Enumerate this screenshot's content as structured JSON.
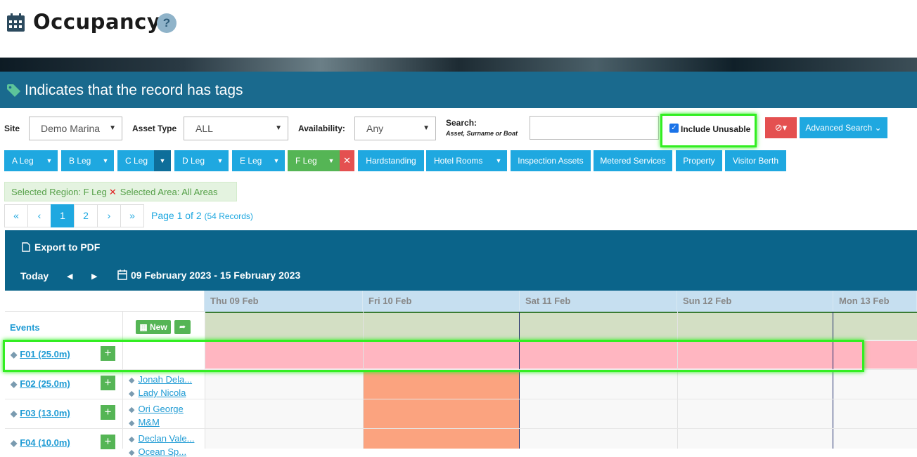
{
  "header": {
    "title": "Occupancy",
    "help": "?"
  },
  "tagbar": {
    "text": "Indicates that the record has tags"
  },
  "filters": {
    "site_label": "Site",
    "site_value": "Demo Marina",
    "asset_type_label": "Asset Type",
    "asset_type_value": "ALL",
    "availability_label": "Availability:",
    "availability_value": "Any",
    "search_label": "Search:",
    "search_hint": "Asset, Surname or Boat",
    "search_value": "",
    "include_unusable_label": "Include Unusable",
    "include_unusable_checked": true,
    "advanced_search_label": "Advanced Search"
  },
  "legs": [
    {
      "label": "A Leg"
    },
    {
      "label": "B Leg"
    },
    {
      "label": "C Leg"
    },
    {
      "label": "D Leg"
    },
    {
      "label": "E Leg"
    },
    {
      "label": "F Leg"
    }
  ],
  "extra_buttons": [
    {
      "label": "Hardstanding"
    },
    {
      "label": "Hotel Rooms"
    },
    {
      "label": "Inspection Assets"
    },
    {
      "label": "Metered Services"
    },
    {
      "label": "Property"
    },
    {
      "label": "Visitor Berth"
    }
  ],
  "selection": {
    "region": "Selected Region: F Leg",
    "area": "Selected Area: All Areas"
  },
  "pagination": {
    "first": "«",
    "prev": "‹",
    "pages": [
      "1",
      "2"
    ],
    "next": "›",
    "last": "»",
    "info": "Page 1 of 2",
    "records": "(54 Records)"
  },
  "calendar": {
    "export_label": "Export to PDF",
    "today_label": "Today",
    "range": "09 February 2023 - 15 February 2023",
    "days": [
      "Thu 09 Feb",
      "Fri 10 Feb",
      "Sat 11 Feb",
      "Sun 12 Feb",
      "Mon 13 Feb"
    ],
    "events_label": "Events",
    "new_label": "New"
  },
  "rows": [
    {
      "berth": "F01 (25.0m)",
      "guests": []
    },
    {
      "berth": "F02 (25.0m)",
      "guests": [
        "Jonah Dela...",
        "Lady Nicola"
      ]
    },
    {
      "berth": "F03 (13.0m)",
      "guests": [
        "Ori George",
        "M&M"
      ]
    },
    {
      "berth": "F04 (10.0m)",
      "guests": [
        "Declan Vale...",
        "Ocean Sp..."
      ]
    }
  ],
  "colors": {
    "accent": "#1fa8e0",
    "header_bar": "#1a6a8e",
    "unusable": "#ffb6c1",
    "booking": "#fba37f",
    "green": "#55b555"
  }
}
